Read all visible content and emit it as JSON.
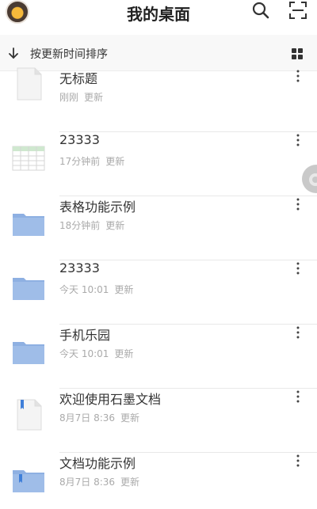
{
  "header": {
    "title": "我的桌面"
  },
  "sortbar": {
    "label": "按更新时间排序"
  },
  "files": [
    {
      "name": "无标题",
      "time": "刚刚",
      "action": "更新",
      "type": "doc"
    },
    {
      "name": "23333",
      "time": "17分钟前",
      "action": "更新",
      "type": "sheet"
    },
    {
      "name": "表格功能示例",
      "time": "18分钟前",
      "action": "更新",
      "type": "folder"
    },
    {
      "name": "23333",
      "time": "今天 10:01",
      "action": "更新",
      "type": "folder"
    },
    {
      "name": "手机乐园",
      "time": "今天 10:01",
      "action": "更新",
      "type": "folder"
    },
    {
      "name": "欢迎使用石墨文档",
      "time": "8月7日 8:36",
      "action": "更新",
      "type": "doc-bookmark"
    },
    {
      "name": "文档功能示例",
      "time": "8月7日 8:36",
      "action": "更新",
      "type": "folder-bookmark"
    }
  ],
  "colors": {
    "folder": "#9fbde8",
    "folder_tab": "#8eb0e2",
    "bookmark": "#3f7fd9",
    "sheet_green": "#cfe8cf"
  },
  "icons": {
    "search": "search-icon",
    "scan": "scan-icon",
    "sort": "arrow-down-icon",
    "grid": "grid-view-icon",
    "more": "more-vertical-icon"
  }
}
